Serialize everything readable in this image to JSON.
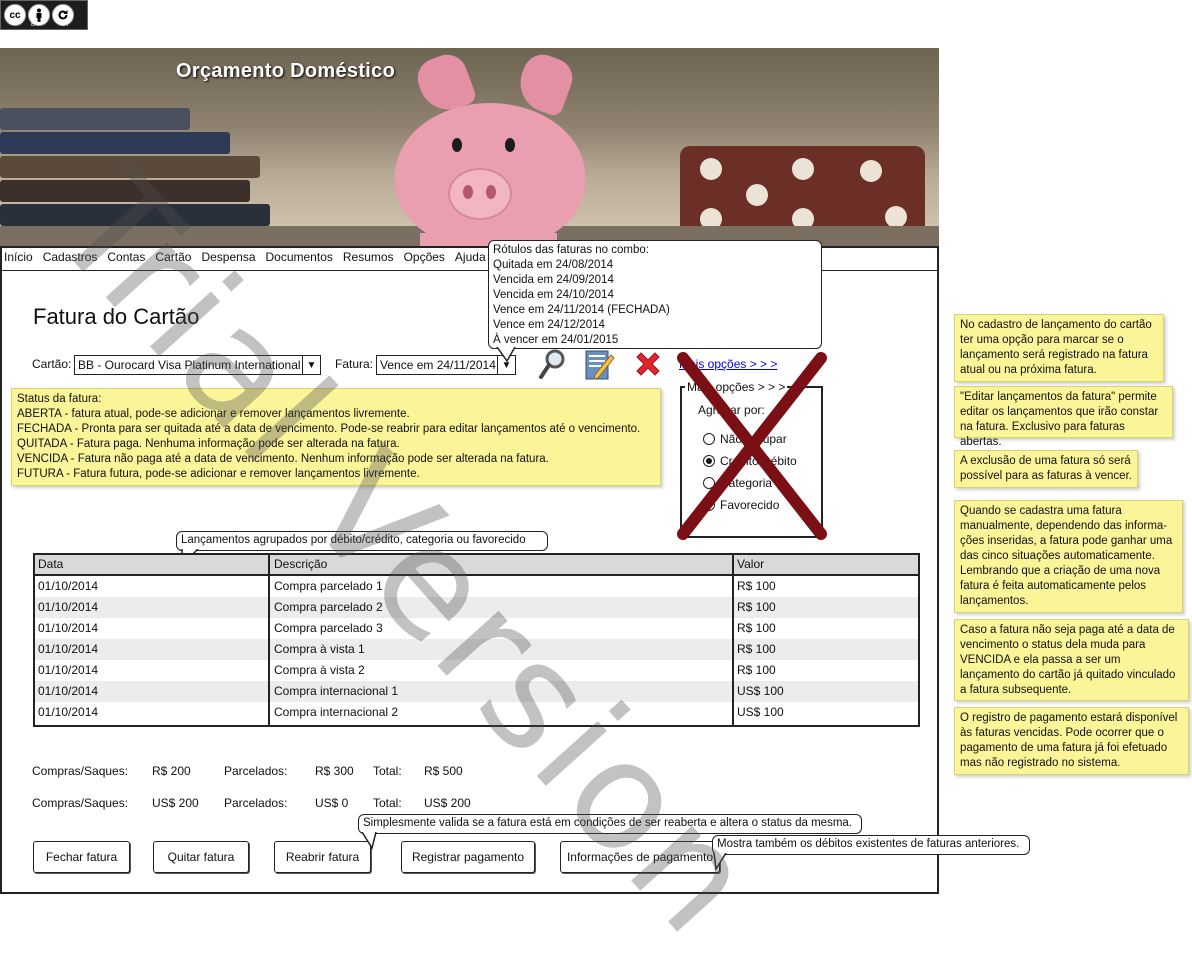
{
  "license_badge": {
    "cc": "cc",
    "by": "BY",
    "sa": "SA"
  },
  "banner": {
    "title": "Orçamento Doméstico"
  },
  "nav": [
    "Início",
    "Cadastros",
    "Contas",
    "Cartão",
    "Despensa",
    "Documentos",
    "Resumos",
    "Opções",
    "Ajuda"
  ],
  "page_title": "Fatura do Cartão",
  "card": {
    "label": "Cartão:",
    "value": "BB - Ourocard Visa Platinum International"
  },
  "invoice": {
    "label": "Fatura:",
    "value": "Vence em 24/11/2014"
  },
  "more_options_link": "Mais opções > > >",
  "more_options_panel": {
    "title": "Mais opções > > >",
    "group_label": "Agrupar por:",
    "options": [
      "Não agrupar",
      "Crédito/Débito",
      "Categoria",
      "Favorecido"
    ],
    "selected": "Crédito/Débito"
  },
  "combo_bubble": {
    "title": "Rótulos das faturas no combo:",
    "lines": [
      "Quitada em 24/08/2014",
      "Vencida em 24/09/2014",
      "Vencida em 24/10/2014",
      "Vence em 24/11/2014 (FECHADA)",
      "Vence em 24/12/2014",
      "À vencer em 24/01/2015"
    ]
  },
  "status_note": {
    "title": "Status da fatura:",
    "lines": [
      "ABERTA - fatura atual, pode-se adicionar e remover lançamentos livremente.",
      "FECHADA - Pronta para ser quitada até a data de vencimento. Pode-se reabrir para editar lançamentos até o vencimento.",
      "QUITADA - Fatura paga. Nenhuma informação pode ser alterada na fatura.",
      "VENCIDA - Fatura não paga até a data de vencimento. Nenhum informação pode ser alterada na fatura.",
      "FUTURA - Fatura futura, pode-se adicionar e remover lançamentos livremente."
    ]
  },
  "group_bubble": "Lançamentos agrupados por débito/crédito, categoria ou favorecido",
  "table": {
    "headers": [
      "Data",
      "Descrição",
      "Valor"
    ],
    "rows": [
      [
        "01/10/2014",
        "Compra parcelado 1",
        "R$ 100"
      ],
      [
        "01/10/2014",
        "Compra parcelado 2",
        "R$ 100"
      ],
      [
        "01/10/2014",
        "Compra parcelado 3",
        "R$ 100"
      ],
      [
        "01/10/2014",
        "Compra à vista 1",
        "R$ 100"
      ],
      [
        "01/10/2014",
        "Compra à vista 2",
        "R$ 100"
      ],
      [
        "01/10/2014",
        "Compra internacional 1",
        "US$ 100"
      ],
      [
        "01/10/2014",
        "Compra internacional 2",
        "US$ 100"
      ]
    ]
  },
  "totals": [
    {
      "compras_label": "Compras/Saques:",
      "compras": "R$ 200",
      "parc_label": "Parcelados:",
      "parc": "R$ 300",
      "total_label": "Total:",
      "total": "R$ 500"
    },
    {
      "compras_label": "Compras/Saques:",
      "compras": "US$ 200",
      "parc_label": "Parcelados:",
      "parc": "US$ 0",
      "total_label": "Total:",
      "total": "US$ 200"
    }
  ],
  "buttons": {
    "close": "Fechar fatura",
    "pay": "Quitar fatura",
    "reopen": "Reabrir fatura",
    "register": "Registrar pagamento",
    "info": "Informações de pagamento"
  },
  "reopen_bubble": "Simplesmente valida se a fatura está em condições de ser reaberta e altera o status da mesma.",
  "info_bubble": "Mostra também os débitos existentes de faturas anteriores.",
  "side_notes": [
    "No cadastro de lançamento do cartão ter uma opção para marcar se o lançamento será registrado na fatura atual ou na próxima fatura.",
    "\"Editar lançamentos da fatura\" permite editar os lançamentos que irão constar na fatura. Exclusivo para faturas abertas.",
    "A exclusão de uma fatura só será possível para as faturas à vencer.",
    "Quando se cadastra uma fatura manualmente, dependendo das informa-ções inseridas, a fatura pode ganhar uma das cinco situações automaticamente. Lembrando que a criação de uma nova fatura é feita automaticamente pelos lançamentos.",
    "Caso a fatura não seja paga até a data de vencimento o status dela muda para VENCIDA e ela passa a ser um lançamento do cartão já quitado vinculado a fatura subsequente.",
    "O registro de pagamento estará disponível às faturas vencidas. Pode ocorrer que o pagamento de uma fatura já foi efetuado mas não registrado no sistema."
  ],
  "watermark": "Trial Version",
  "icons": [
    "search-icon",
    "edit-icon",
    "delete-icon",
    "crossed-out-mark"
  ],
  "colors": {
    "note_yellow": "#fbf59a",
    "delete_red": "#e3262e",
    "cross_maroon": "#7a1015",
    "link_blue": "#0000ee"
  }
}
